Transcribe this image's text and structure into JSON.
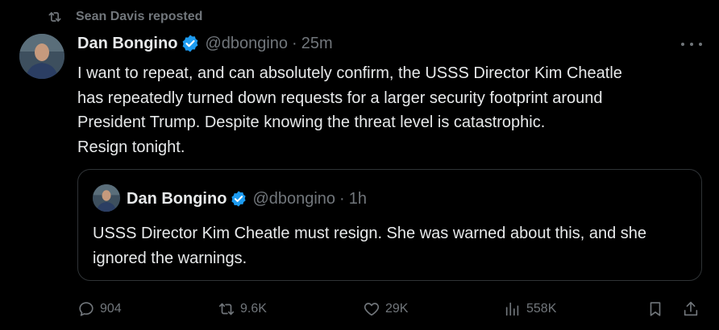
{
  "repost_banner": {
    "text": "Sean Davis reposted",
    "icon": "repost-icon"
  },
  "tweet": {
    "author_name": "Dan Bongino",
    "handle": "@dbongino",
    "separator": "·",
    "time": "25m",
    "verified_icon": "verified-badge-icon",
    "more_icon": "more-icon",
    "text": "I want to repeat, and can absolutely confirm, the USSS Director Kim Cheatle\nhas repeatedly turned down requests for a larger security footprint around\nPresident Trump. Despite knowing the threat level is catastrophic.\nResign tonight."
  },
  "quoted_tweet": {
    "author_name": "Dan Bongino",
    "handle": "@dbongino",
    "separator": "·",
    "time": "1h",
    "text": "USSS Director Kim Cheatle must resign. She was warned about this, and she ignored the warnings."
  },
  "actions": {
    "replies": "904",
    "reposts": "9.6K",
    "likes": "29K",
    "views": "558K"
  },
  "colors": {
    "background": "#000000",
    "text": "#e7e9ea",
    "muted": "#71767b",
    "verified": "#1d9bf0",
    "border": "#2f3336"
  }
}
